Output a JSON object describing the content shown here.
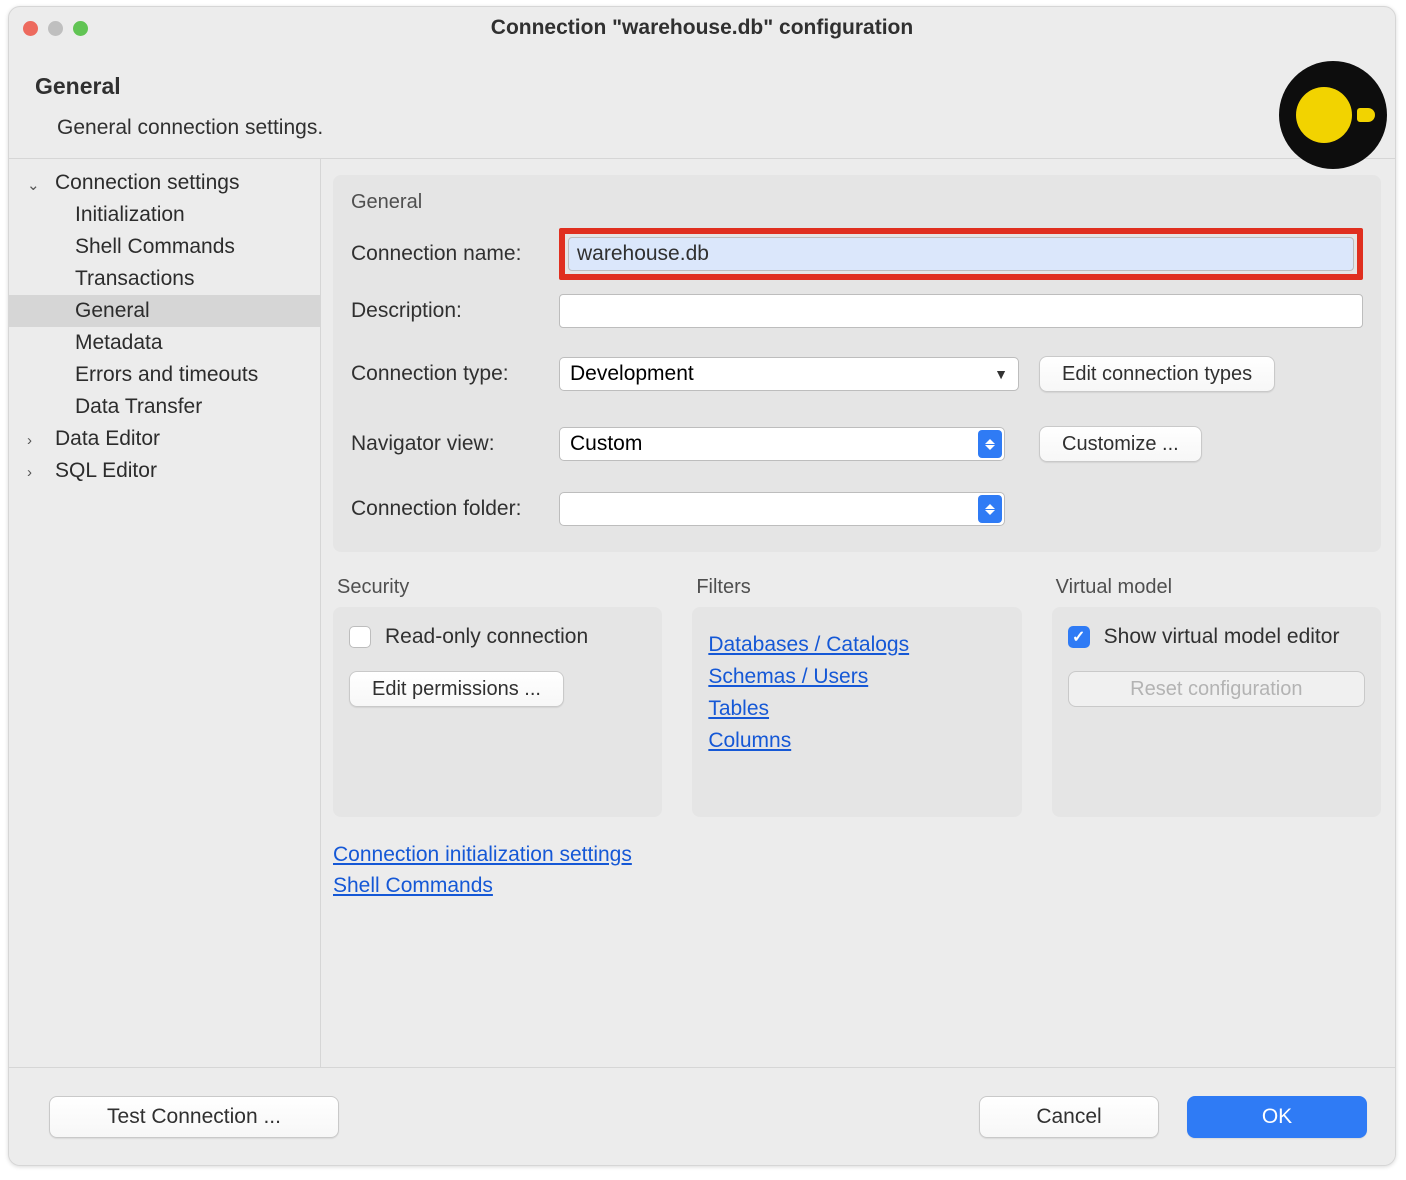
{
  "window": {
    "title": "Connection \"warehouse.db\" configuration"
  },
  "header": {
    "title": "General",
    "subtitle": "General connection settings."
  },
  "sidebar": {
    "items": [
      {
        "label": "Connection settings",
        "kind": "top",
        "expanded": true
      },
      {
        "label": "Initialization",
        "kind": "sub"
      },
      {
        "label": "Shell Commands",
        "kind": "sub"
      },
      {
        "label": "Transactions",
        "kind": "sub"
      },
      {
        "label": "General",
        "kind": "sub",
        "selected": true
      },
      {
        "label": "Metadata",
        "kind": "sub"
      },
      {
        "label": "Errors and timeouts",
        "kind": "sub"
      },
      {
        "label": "Data Transfer",
        "kind": "sub"
      },
      {
        "label": "Data Editor",
        "kind": "top",
        "expanded": false
      },
      {
        "label": "SQL Editor",
        "kind": "top",
        "expanded": false
      }
    ]
  },
  "general": {
    "group_label": "General",
    "conn_name_label": "Connection name:",
    "conn_name_value": "warehouse.db",
    "description_label": "Description:",
    "description_value": "",
    "conn_type_label": "Connection type:",
    "conn_type_value": "Development",
    "edit_conn_types_btn": "Edit connection types",
    "nav_view_label": "Navigator view:",
    "nav_view_value": "Custom",
    "customize_btn": "Customize ...",
    "conn_folder_label": "Connection folder:",
    "conn_folder_value": ""
  },
  "security": {
    "title": "Security",
    "readonly_label": "Read-only connection",
    "readonly_checked": false,
    "edit_perm_btn": "Edit permissions ..."
  },
  "filters": {
    "title": "Filters",
    "links": [
      "Databases / Catalogs",
      "Schemas / Users",
      "Tables",
      "Columns"
    ]
  },
  "virtual": {
    "title": "Virtual model",
    "show_label": "Show virtual model editor",
    "show_checked": true,
    "reset_btn": "Reset configuration"
  },
  "links": {
    "init": "Connection initialization settings",
    "shell": "Shell Commands"
  },
  "footer": {
    "test": "Test Connection ...",
    "cancel": "Cancel",
    "ok": "OK"
  }
}
